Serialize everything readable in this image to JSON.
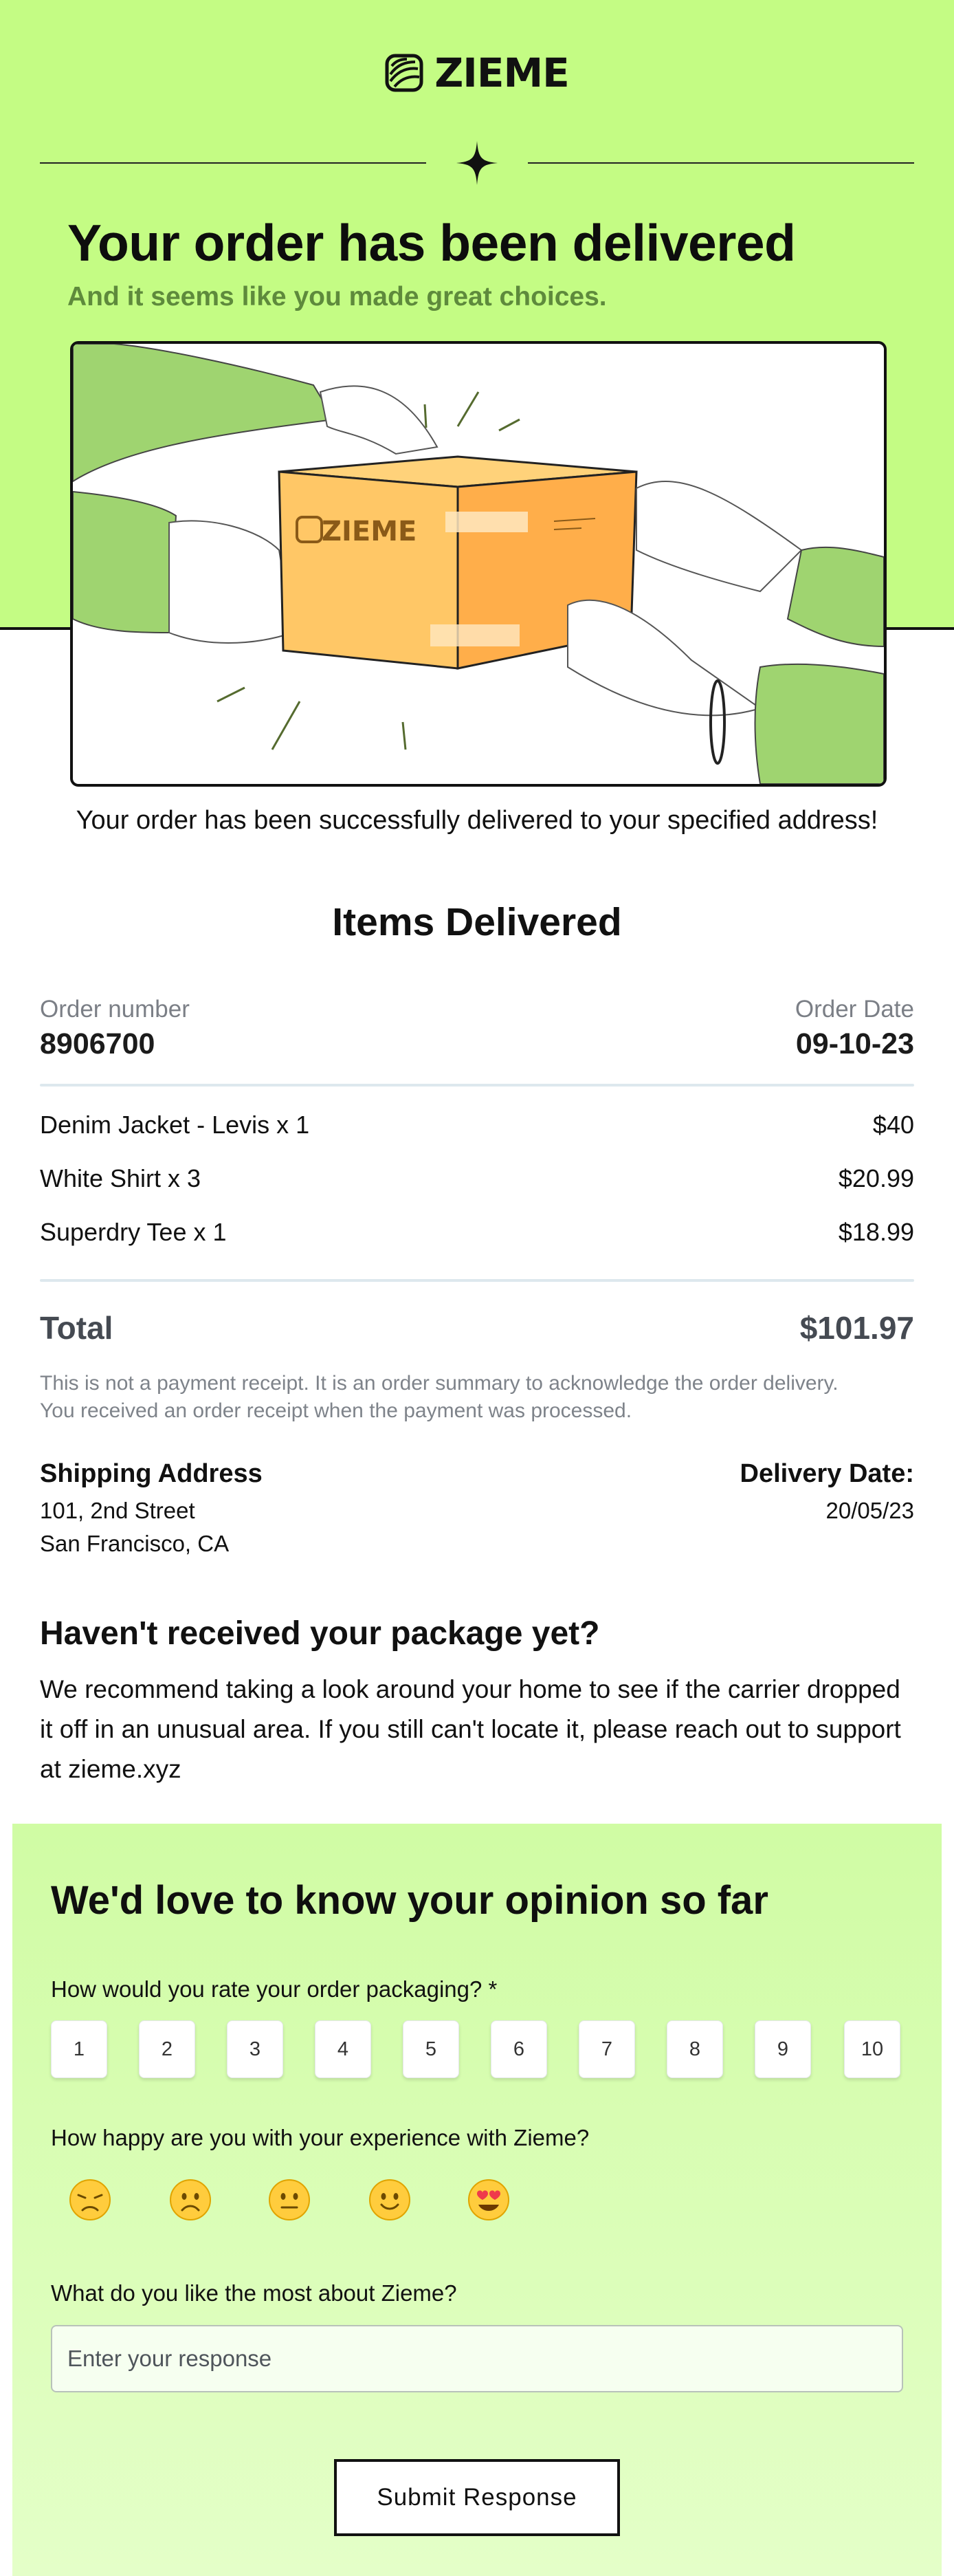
{
  "brand": {
    "name": "ZIEME",
    "box_label": "ZIEME"
  },
  "hero": {
    "title": "Your order has been delivered",
    "subtitle": "And it seems like you made great choices."
  },
  "delivery_message": "Your order has been successfully delivered to your specified address!",
  "items_section": {
    "title": "Items Delivered",
    "order_number_label": "Order number",
    "order_number": "8906700",
    "order_date_label": "Order Date",
    "order_date": "09-10-23",
    "items": [
      {
        "name": "Denim Jacket - Levis x 1",
        "price": "$40"
      },
      {
        "name": "White Shirt x 3",
        "price": "$20.99"
      },
      {
        "name": "Superdry Tee x 1",
        "price": "$18.99"
      }
    ],
    "total_label": "Total",
    "total": "$101.97",
    "note_line1": "This is not a payment receipt. It is an order summary to acknowledge the order delivery.",
    "note_line2": "You received an order receipt when the payment was processed."
  },
  "shipping": {
    "address_label": "Shipping Address",
    "address_line1": "101, 2nd Street",
    "address_line2": "San Francisco, CA",
    "delivery_date_label": "Delivery Date:",
    "delivery_date": "20/05/23"
  },
  "help": {
    "title": "Haven't received your package yet?",
    "body": "We recommend taking a look around your home to see if the carrier dropped it off in an unusual area. If you still can't locate it, please reach out to support at zieme.xyz"
  },
  "survey": {
    "title": "We'd love to know your opinion so far",
    "q1": "How would you rate your order packaging? *",
    "ratings": [
      "1",
      "2",
      "3",
      "4",
      "5",
      "6",
      "7",
      "8",
      "9",
      "10"
    ],
    "q2": "How happy are you with your experience with Zieme?",
    "emojis": [
      "disappointed-face-icon",
      "frowning-face-icon",
      "neutral-face-icon",
      "slightly-smiling-face-icon",
      "heart-eyes-face-icon"
    ],
    "q3": "What do you like the most about Zieme?",
    "response_placeholder": "Enter your response",
    "submit_label": "Submit Response"
  },
  "colors": {
    "hero_green": "#c4fc84",
    "subtitle_green": "#5e8a3c",
    "survey_green": "#d8fcb4",
    "box_orange": "#ffb347"
  }
}
